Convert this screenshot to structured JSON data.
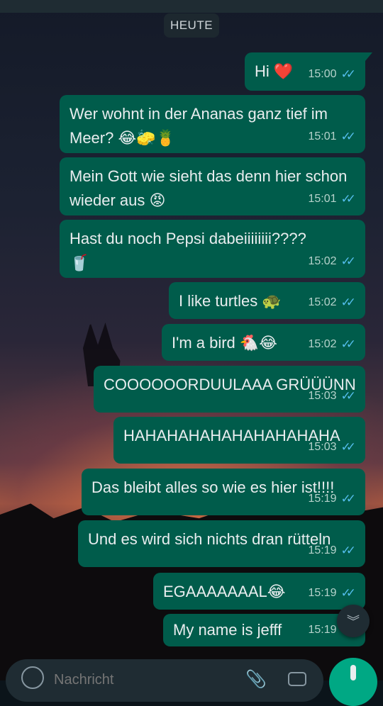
{
  "date_chip": "HEUTE",
  "messages": [
    {
      "text": "Hi ❤️",
      "time": "15:00"
    },
    {
      "text": "Wer wohnt in der Ananas ganz tief im Meer? 😂🧽🍍",
      "time": "15:01"
    },
    {
      "text": "Mein Gott wie sieht das denn hier schon wieder aus 😡",
      "time": "15:01"
    },
    {
      "text": "Hast du noch Pepsi dabeiiiiiiii????\n🥤",
      "time": "15:02"
    },
    {
      "text": "I like turtles 🐢",
      "time": "15:02"
    },
    {
      "text": "I'm a bird 🐔😂",
      "time": "15:02"
    },
    {
      "text": "COOOOOORDUULAAA GRÜÜÜNN",
      "time": "15:03"
    },
    {
      "text": "HAHAHAHAHAHAHAHAHAHA",
      "time": "15:03"
    },
    {
      "text": "Das bleibt alles so wie es hier ist!!!!",
      "time": "15:19"
    },
    {
      "text": "Und es wird sich nichts dran rütteln",
      "time": "15:19"
    },
    {
      "text": "EGAAAAAAAL😂",
      "time": "15:19"
    },
    {
      "text": "My name is jefff",
      "time": "15:19"
    }
  ],
  "read_ticks": "✓✓",
  "scroll_down_glyph": "︾",
  "composer": {
    "placeholder": "Nachricht"
  },
  "colors": {
    "outgoing_bubble": "#005c4b",
    "read_tick": "#53bdeb",
    "accent": "#00a884"
  }
}
